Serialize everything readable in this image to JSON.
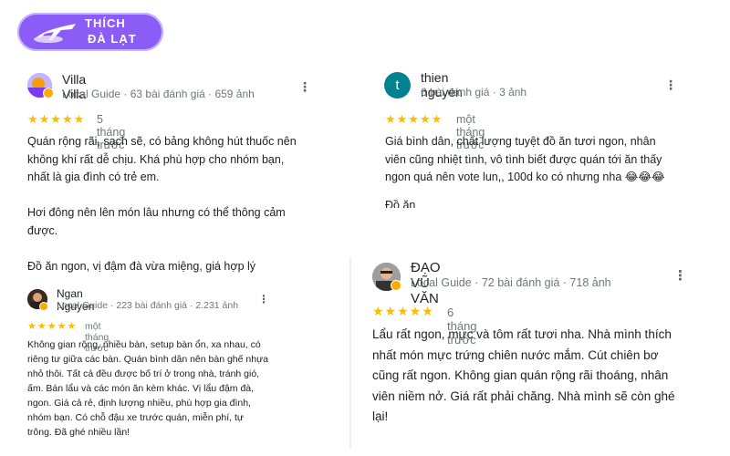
{
  "brand": {
    "line1": "THÍCH",
    "line2": "ĐÀ LẠT",
    "bg": "#8b5cf6"
  },
  "reviews": [
    {
      "name": "Villa Villa",
      "meta": "Local Guide · 63 bài đánh giá · 659 ảnh",
      "stars": "★★★★★",
      "when": "5 tháng trước",
      "text": "Quán rộng rãi, sạch sẽ, có bảng không hút thuốc nên\nkhông khí rất dễ chịu. Khá phù hợp cho nhóm bạn,\nnhất là gia đình có trẻ em.\n\nHơi đông nên lên món lâu nhưng có thể thông cảm\nđược.\n\nĐồ ăn ngon, vị đậm đà vừa miệng, giá hợp lý"
    },
    {
      "name": "thien nguyen",
      "avatar_letter": "t",
      "meta": "6 bài đánh giá · 3 ảnh",
      "stars": "★★★★★",
      "when": "một tháng trước",
      "text": "Giá bình dân, chất lượng tuyệt đồ ăn tươi ngon, nhân\nviên cũng nhiệt tình, vô tình biết được quán tới ăn thấy\nngon quá nên vote lun,, 100d ko có nhưng nha 😂😂😂",
      "clipped_text": "Đồ ăn"
    },
    {
      "name": "Ngan Nguyen",
      "meta": "Local Guide · 223 bài đánh giá · 2.231 ảnh",
      "stars": "★★★★★",
      "when": "một tháng trước",
      "text": "Không gian rộng, nhiều bàn, setup bàn ổn, xa nhau, có\nriêng tư giữa các bàn. Quán bình dân nên bàn ghế nhựa\nnhỏ thôi. Tất cả đều được bố trí ở trong nhà, tránh gió,\nấm. Bán lẩu và các món ăn kèm khác. Vị lẩu đậm đà,\nngon. Giá cả rẻ, định lượng nhiều, phù hợp gia đình,\nnhóm bạn. Có chỗ đậu xe trước quán, miễn phí, tự\ntrông. Đã ghé nhiều lần!"
    },
    {
      "name": "ĐẠO VŨ VĂN",
      "meta": "Local Guide · 72 bài đánh giá · 718 ảnh",
      "stars": "★★★★★",
      "when": "6 tháng trước",
      "text": "Lẩu rất ngon, mực và tôm rất tươi nha. Nhà mình thích\nnhất món mực trứng chiên nước mắm. Cút chiên bơ\ncũng rất ngon. Không gian quán rộng rãi thoáng, nhân\nviên niềm nở. Giá rất phải chăng. Nhà mình sẽ còn ghé\nlại!"
    }
  ],
  "more_icon": "⋮"
}
